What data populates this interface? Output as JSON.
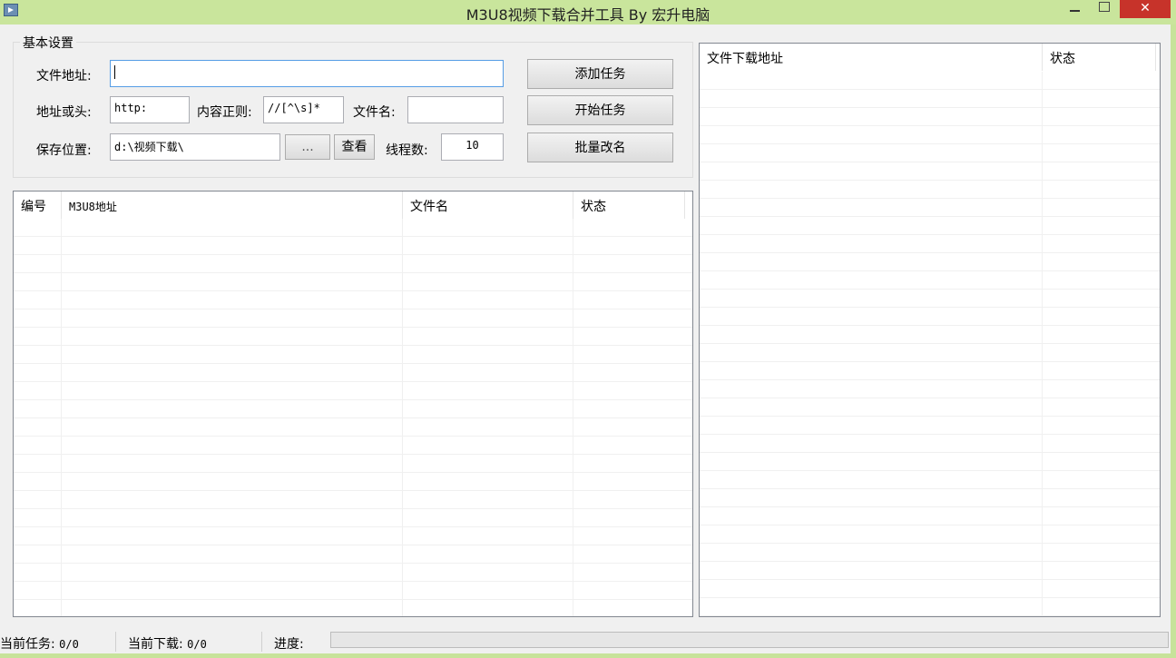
{
  "window": {
    "title": "M3U8视频下载合并工具 By 宏升电脑",
    "close_glyph": "✕"
  },
  "settings": {
    "group_title": "基本设置",
    "file_url_label": "文件地址:",
    "file_url_value": "",
    "url_head_label": "地址或头:",
    "url_head_value": "http:",
    "regex_label": "内容正则:",
    "regex_value": "//[^\\s]*",
    "filename_label": "文件名:",
    "filename_value": "",
    "save_label": "保存位置:",
    "save_value": "d:\\视频下载\\",
    "browse_label": "...",
    "view_label": "查看",
    "threads_label": "线程数:",
    "threads_value": "10"
  },
  "buttons": {
    "add_task": "添加任务",
    "start_task": "开始任务",
    "batch_rename": "批量改名"
  },
  "task_list": {
    "columns": [
      "编号",
      "M3U8地址",
      "文件名",
      "状态"
    ]
  },
  "file_list": {
    "columns": [
      "文件下载地址",
      "状态"
    ]
  },
  "status": {
    "current_task_label": "当前任务:",
    "current_task_value": "0/0",
    "current_download_label": "当前下载:",
    "current_download_value": "0/0",
    "progress_label": "进度:",
    "progress_fraction": 0
  }
}
